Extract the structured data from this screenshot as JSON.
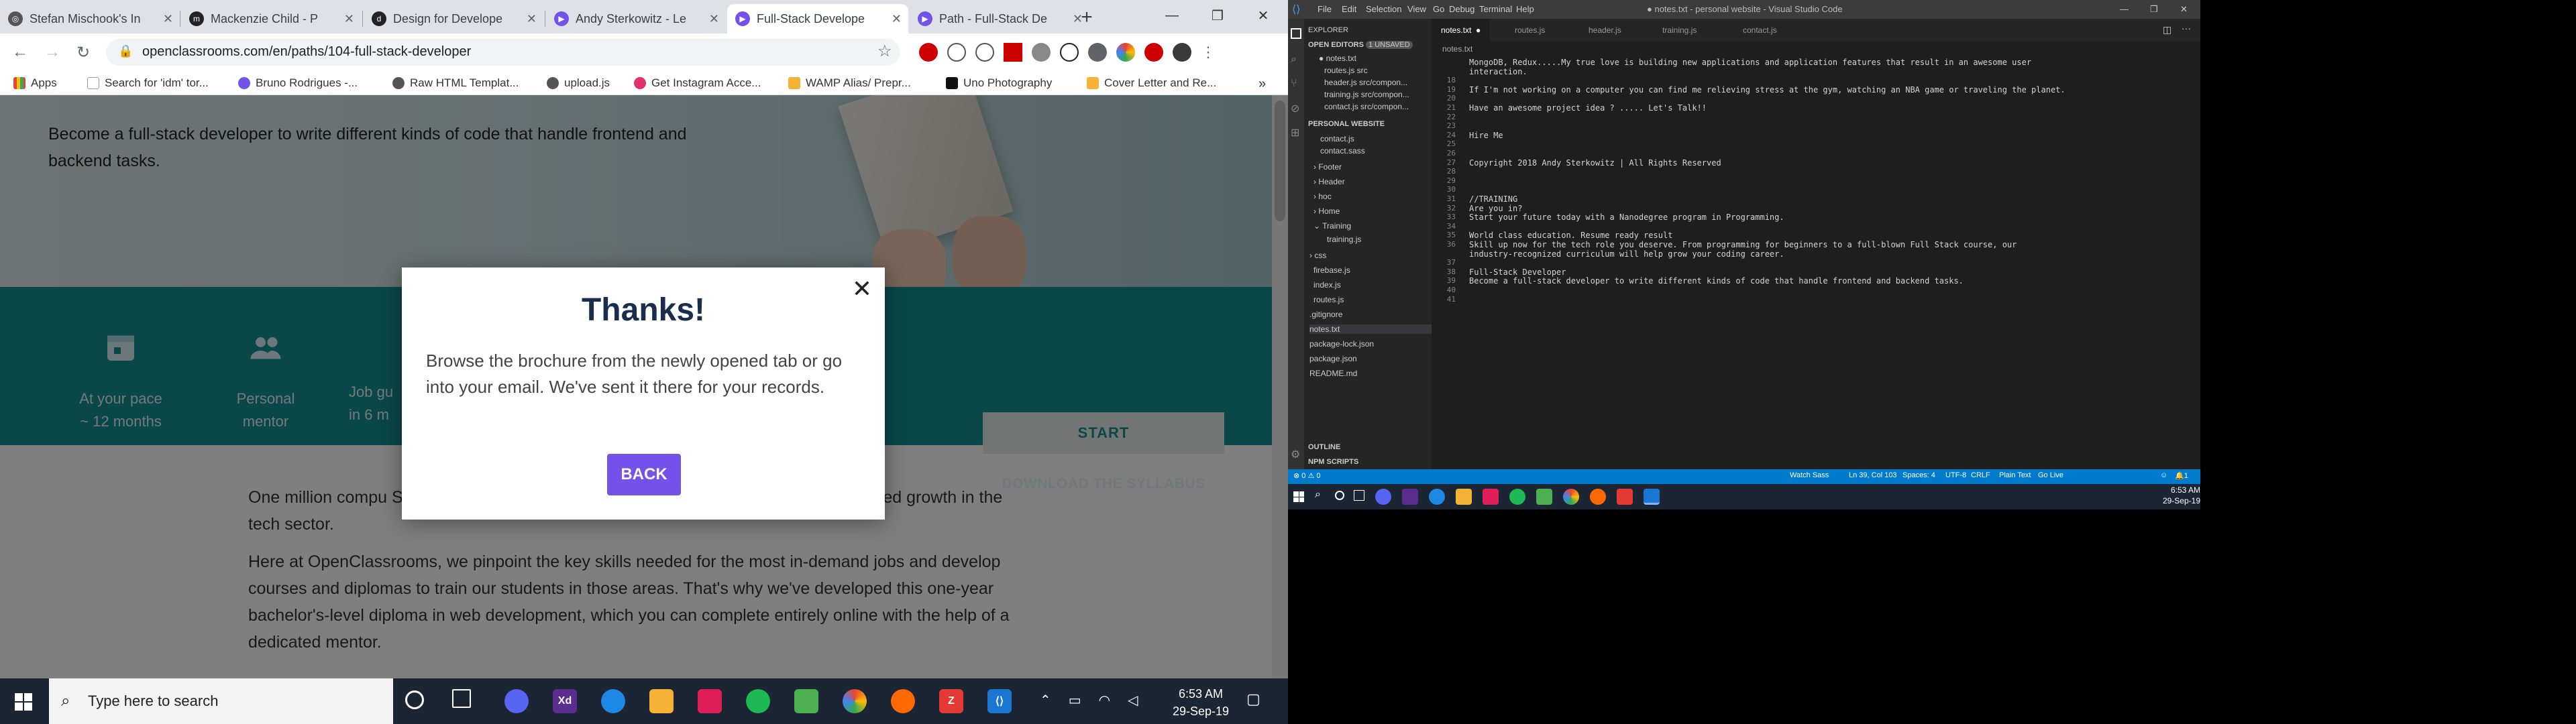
{
  "chrome": {
    "tabs": [
      {
        "title": "Stefan Mischook's In"
      },
      {
        "title": "Mackenzie Child - P"
      },
      {
        "title": "Design for Develope"
      },
      {
        "title": "Andy Sterkowitz - Le"
      },
      {
        "title": "Full-Stack Develope"
      },
      {
        "title": "Path - Full-Stack De"
      }
    ],
    "new_tab": "+",
    "url": "openclassrooms.com/en/paths/104-full-stack-developer",
    "bookmarks": [
      {
        "label": "Apps"
      },
      {
        "label": "Search for 'idm' tor..."
      },
      {
        "label": "Bruno Rodrigues -..."
      },
      {
        "label": "Raw HTML Templat..."
      },
      {
        "label": "upload.js"
      },
      {
        "label": "Get Instagram Acce..."
      },
      {
        "label": "WAMP Alias/ Prepr..."
      },
      {
        "label": "Uno Photography"
      },
      {
        "label": "Cover Letter and Re..."
      }
    ]
  },
  "page": {
    "hero_text": "Become a full-stack developer to write different kinds of code that handle frontend and backend tasks.",
    "features": [
      {
        "line1": "At your pace",
        "line2": "~ 12 months"
      },
      {
        "line1": "Personal",
        "line2": "mentor"
      },
      {
        "line1": "Job gu",
        "line2": "in 6 m"
      }
    ],
    "start_label": "START",
    "download_label": "DOWNLOAD THE SYLLABUS",
    "para1": "One million compu                                                                    S. by 2020 - as well as 700,000 in Europe - thanks to unprecedented growth in the tech sector.",
    "para2": "Here at OpenClassrooms, we pinpoint the key skills needed for the most in-demand jobs and develop courses and diplomas to train our students in those areas. That's why we've developed this one-year bachelor's-level diploma in web development, which you can complete entirely online with the help of a dedicated mentor."
  },
  "modal": {
    "title": "Thanks!",
    "text": "Browse the brochure from the newly opened tab or go into your email. We've sent it there for your records.",
    "back_label": "BACK"
  },
  "taskbar": {
    "search_placeholder": "Type here to search",
    "time": "6:53 AM",
    "date": "29-Sep-19"
  },
  "vscode": {
    "title": "● notes.txt - personal website - Visual Studio Code",
    "menu": [
      "File",
      "Edit",
      "Selection",
      "View",
      "Go",
      "Debug",
      "Terminal",
      "Help"
    ],
    "explorer_title": "EXPLORER",
    "open_editors": "OPEN EDITORS",
    "unsaved": "1 UNSAVED",
    "open_files": [
      "● notes.txt",
      "routes.js src",
      "header.js src/compon...",
      "training.js src/compon...",
      "contact.js src/compon..."
    ],
    "project": "PERSONAL WEBSITE",
    "tree": [
      "contact.js",
      "contact.sass",
      "Footer",
      "Header",
      "hoc",
      "Home",
      "Training",
      "training.js",
      "css",
      "firebase.js",
      "index.js",
      "routes.js",
      ".gitignore",
      "notes.txt",
      "package-lock.json",
      "package.json",
      "README.md"
    ],
    "outline": "OUTLINE",
    "npm": "NPM SCRIPTS",
    "tabs": [
      "notes.txt",
      "routes.js",
      "header.js",
      "training.js",
      "contact.js"
    ],
    "breadcrumb": "notes.txt",
    "lines": [
      {
        "n": "",
        "t": "MongoDB, Redux.....My true love is building new applications and application features that result in an awesome user"
      },
      {
        "n": "",
        "t": "interaction."
      },
      {
        "n": "18",
        "t": ""
      },
      {
        "n": "19",
        "t": "If I'm not working on a computer you can find me relieving stress at the gym, watching an NBA game or traveling the planet."
      },
      {
        "n": "20",
        "t": ""
      },
      {
        "n": "21",
        "t": "Have an awesome project idea ? ..... Let's Talk!!"
      },
      {
        "n": "22",
        "t": ""
      },
      {
        "n": "23",
        "t": ""
      },
      {
        "n": "24",
        "t": "Hire Me"
      },
      {
        "n": "25",
        "t": ""
      },
      {
        "n": "26",
        "t": ""
      },
      {
        "n": "27",
        "t": "Copyright 2018 Andy Sterkowitz | All Rights Reserved"
      },
      {
        "n": "28",
        "t": ""
      },
      {
        "n": "29",
        "t": ""
      },
      {
        "n": "30",
        "t": ""
      },
      {
        "n": "31",
        "t": "//TRAINING"
      },
      {
        "n": "32",
        "t": "Are you in?"
      },
      {
        "n": "33",
        "t": "Start your future today with a Nanodegree program in Programming."
      },
      {
        "n": "34",
        "t": ""
      },
      {
        "n": "35",
        "t": "World class education. Resume ready result"
      },
      {
        "n": "36",
        "t": "Skill up now for the tech role you deserve. From programming for beginners to a full-blown Full Stack course, our"
      },
      {
        "n": "",
        "t": "industry-recognized curriculum will help grow your coding career."
      },
      {
        "n": "37",
        "t": ""
      },
      {
        "n": "38",
        "t": "Full-Stack Developer"
      },
      {
        "n": "39",
        "t": "Become a full-stack developer to write different kinds of code that handle frontend and backend tasks."
      },
      {
        "n": "40",
        "t": ""
      },
      {
        "n": "41",
        "t": ""
      }
    ],
    "status": {
      "left": "⊗ 0 ⚠ 0",
      "watch": "Watch Sass",
      "pos": "Ln 39, Col 103",
      "spaces": "Spaces: 4",
      "enc": "UTF-8",
      "eol": "CRLF",
      "lang": "Plain Text",
      "live": "Go Live",
      "bell": "1"
    },
    "time": "6:53 AM",
    "date": "29-Sep-19"
  },
  "colors": {
    "teal": "#148e93",
    "purple": "#7451eb",
    "navy": "#1b2d4c",
    "vs_blue": "#007acc"
  }
}
